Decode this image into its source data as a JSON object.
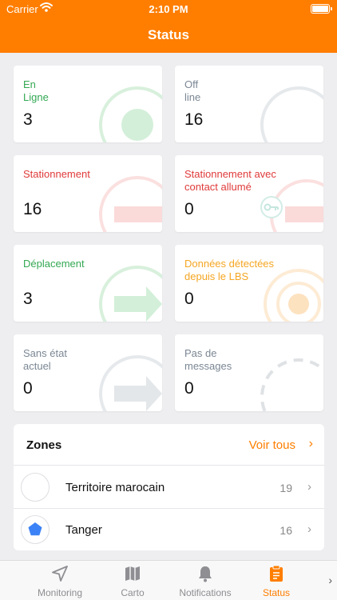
{
  "status_bar": {
    "carrier": "Carrier",
    "time": "2:10 PM"
  },
  "nav": {
    "title": "Status"
  },
  "cards": [
    {
      "label_lines": [
        "En",
        "Ligne"
      ],
      "value": "3",
      "color": "#34a853"
    },
    {
      "label_lines": [
        "Off",
        "line"
      ],
      "value": "16",
      "color": "#7b8794"
    },
    {
      "label_lines": [
        "Stationnement"
      ],
      "value": "16",
      "color": "#e03a3a"
    },
    {
      "label_lines": [
        "Stationnement avec",
        "contact allumé"
      ],
      "value": "0",
      "color": "#e03a3a"
    },
    {
      "label_lines": [
        "Déplacement"
      ],
      "value": "3",
      "color": "#34a853"
    },
    {
      "label_lines": [
        "Données détectées",
        "depuis le LBS"
      ],
      "value": "0",
      "color": "#f5a623"
    },
    {
      "label_lines": [
        "Sans état",
        "actuel"
      ],
      "value": "0",
      "color": "#7b8794"
    },
    {
      "label_lines": [
        "Pas de",
        "messages"
      ],
      "value": "0",
      "color": "#7b8794"
    }
  ],
  "zones": {
    "title": "Zones",
    "view_all": "Voir tous",
    "items": [
      {
        "name": "Territoire marocain",
        "count": "19",
        "icon": "circle-empty-icon"
      },
      {
        "name": "Tanger",
        "count": "16",
        "icon": "pentagon-icon",
        "icon_color": "#3b82f6"
      }
    ]
  },
  "tabs": [
    {
      "label": "Monitoring",
      "icon": "navigation-arrow-icon"
    },
    {
      "label": "Carto",
      "icon": "map-icon"
    },
    {
      "label": "Notifications",
      "icon": "bell-icon"
    },
    {
      "label": "Status",
      "icon": "clipboard-icon",
      "active": true
    }
  ]
}
